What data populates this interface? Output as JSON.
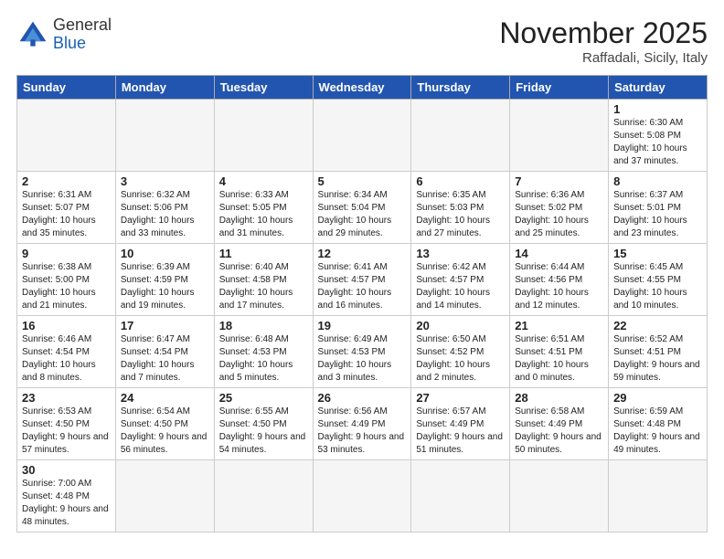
{
  "header": {
    "logo_line1": "General",
    "logo_line2": "Blue",
    "month": "November 2025",
    "location": "Raffadali, Sicily, Italy"
  },
  "weekdays": [
    "Sunday",
    "Monday",
    "Tuesday",
    "Wednesday",
    "Thursday",
    "Friday",
    "Saturday"
  ],
  "weeks": [
    [
      {
        "day": "",
        "info": ""
      },
      {
        "day": "",
        "info": ""
      },
      {
        "day": "",
        "info": ""
      },
      {
        "day": "",
        "info": ""
      },
      {
        "day": "",
        "info": ""
      },
      {
        "day": "",
        "info": ""
      },
      {
        "day": "1",
        "info": "Sunrise: 6:30 AM\nSunset: 5:08 PM\nDaylight: 10 hours and 37 minutes."
      }
    ],
    [
      {
        "day": "2",
        "info": "Sunrise: 6:31 AM\nSunset: 5:07 PM\nDaylight: 10 hours and 35 minutes."
      },
      {
        "day": "3",
        "info": "Sunrise: 6:32 AM\nSunset: 5:06 PM\nDaylight: 10 hours and 33 minutes."
      },
      {
        "day": "4",
        "info": "Sunrise: 6:33 AM\nSunset: 5:05 PM\nDaylight: 10 hours and 31 minutes."
      },
      {
        "day": "5",
        "info": "Sunrise: 6:34 AM\nSunset: 5:04 PM\nDaylight: 10 hours and 29 minutes."
      },
      {
        "day": "6",
        "info": "Sunrise: 6:35 AM\nSunset: 5:03 PM\nDaylight: 10 hours and 27 minutes."
      },
      {
        "day": "7",
        "info": "Sunrise: 6:36 AM\nSunset: 5:02 PM\nDaylight: 10 hours and 25 minutes."
      },
      {
        "day": "8",
        "info": "Sunrise: 6:37 AM\nSunset: 5:01 PM\nDaylight: 10 hours and 23 minutes."
      }
    ],
    [
      {
        "day": "9",
        "info": "Sunrise: 6:38 AM\nSunset: 5:00 PM\nDaylight: 10 hours and 21 minutes."
      },
      {
        "day": "10",
        "info": "Sunrise: 6:39 AM\nSunset: 4:59 PM\nDaylight: 10 hours and 19 minutes."
      },
      {
        "day": "11",
        "info": "Sunrise: 6:40 AM\nSunset: 4:58 PM\nDaylight: 10 hours and 17 minutes."
      },
      {
        "day": "12",
        "info": "Sunrise: 6:41 AM\nSunset: 4:57 PM\nDaylight: 10 hours and 16 minutes."
      },
      {
        "day": "13",
        "info": "Sunrise: 6:42 AM\nSunset: 4:57 PM\nDaylight: 10 hours and 14 minutes."
      },
      {
        "day": "14",
        "info": "Sunrise: 6:44 AM\nSunset: 4:56 PM\nDaylight: 10 hours and 12 minutes."
      },
      {
        "day": "15",
        "info": "Sunrise: 6:45 AM\nSunset: 4:55 PM\nDaylight: 10 hours and 10 minutes."
      }
    ],
    [
      {
        "day": "16",
        "info": "Sunrise: 6:46 AM\nSunset: 4:54 PM\nDaylight: 10 hours and 8 minutes."
      },
      {
        "day": "17",
        "info": "Sunrise: 6:47 AM\nSunset: 4:54 PM\nDaylight: 10 hours and 7 minutes."
      },
      {
        "day": "18",
        "info": "Sunrise: 6:48 AM\nSunset: 4:53 PM\nDaylight: 10 hours and 5 minutes."
      },
      {
        "day": "19",
        "info": "Sunrise: 6:49 AM\nSunset: 4:53 PM\nDaylight: 10 hours and 3 minutes."
      },
      {
        "day": "20",
        "info": "Sunrise: 6:50 AM\nSunset: 4:52 PM\nDaylight: 10 hours and 2 minutes."
      },
      {
        "day": "21",
        "info": "Sunrise: 6:51 AM\nSunset: 4:51 PM\nDaylight: 10 hours and 0 minutes."
      },
      {
        "day": "22",
        "info": "Sunrise: 6:52 AM\nSunset: 4:51 PM\nDaylight: 9 hours and 59 minutes."
      }
    ],
    [
      {
        "day": "23",
        "info": "Sunrise: 6:53 AM\nSunset: 4:50 PM\nDaylight: 9 hours and 57 minutes."
      },
      {
        "day": "24",
        "info": "Sunrise: 6:54 AM\nSunset: 4:50 PM\nDaylight: 9 hours and 56 minutes."
      },
      {
        "day": "25",
        "info": "Sunrise: 6:55 AM\nSunset: 4:50 PM\nDaylight: 9 hours and 54 minutes."
      },
      {
        "day": "26",
        "info": "Sunrise: 6:56 AM\nSunset: 4:49 PM\nDaylight: 9 hours and 53 minutes."
      },
      {
        "day": "27",
        "info": "Sunrise: 6:57 AM\nSunset: 4:49 PM\nDaylight: 9 hours and 51 minutes."
      },
      {
        "day": "28",
        "info": "Sunrise: 6:58 AM\nSunset: 4:49 PM\nDaylight: 9 hours and 50 minutes."
      },
      {
        "day": "29",
        "info": "Sunrise: 6:59 AM\nSunset: 4:48 PM\nDaylight: 9 hours and 49 minutes."
      }
    ],
    [
      {
        "day": "30",
        "info": "Sunrise: 7:00 AM\nSunset: 4:48 PM\nDaylight: 9 hours and 48 minutes."
      },
      {
        "day": "",
        "info": ""
      },
      {
        "day": "",
        "info": ""
      },
      {
        "day": "",
        "info": ""
      },
      {
        "day": "",
        "info": ""
      },
      {
        "day": "",
        "info": ""
      },
      {
        "day": "",
        "info": ""
      }
    ]
  ]
}
